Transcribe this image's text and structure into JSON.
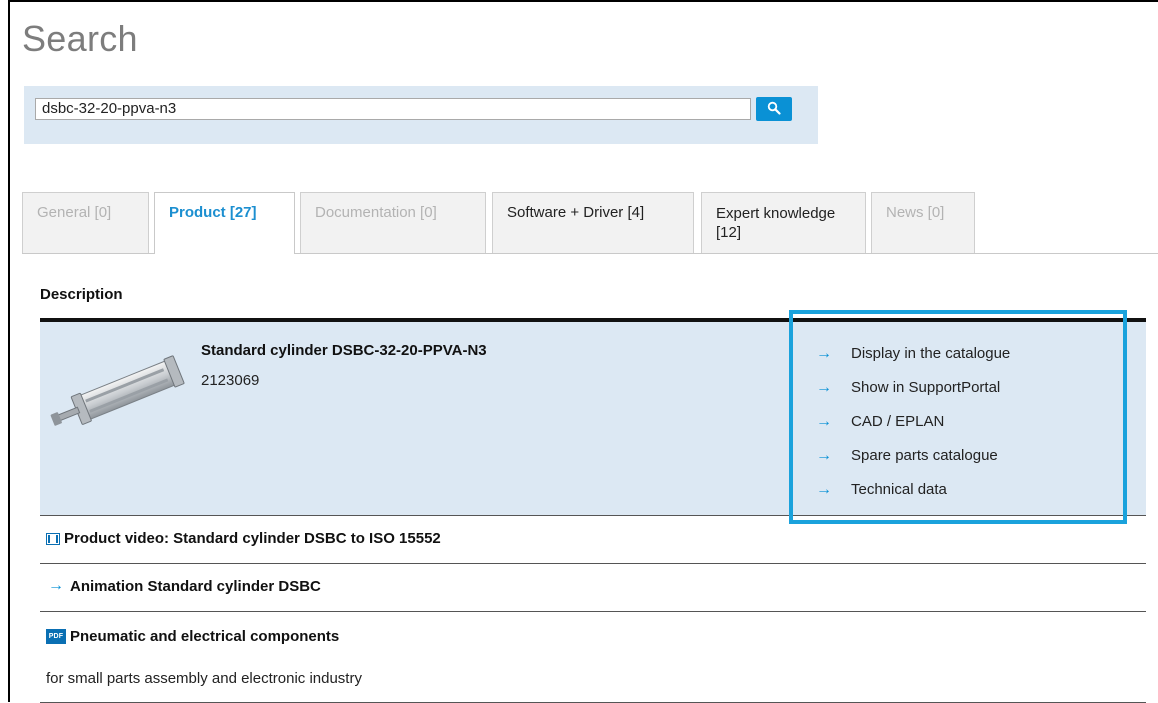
{
  "page": {
    "title": "Search"
  },
  "search": {
    "value": "dsbc-32-20-ppva-n3",
    "button_icon": "search-icon"
  },
  "tabs": [
    {
      "label": "General [0]",
      "state": "disabled"
    },
    {
      "label": "Product [27]",
      "state": "active"
    },
    {
      "label": "Documentation [0]",
      "state": "disabled"
    },
    {
      "label": "Software + Driver [4]",
      "state": "enabled"
    },
    {
      "label": "Expert knowledge [12]",
      "state": "enabled"
    },
    {
      "label": "News [0]",
      "state": "disabled"
    }
  ],
  "results": {
    "header": "Description",
    "product": {
      "title": "Standard cylinder DSBC-32-20-PPVA-N3",
      "number": "2123069",
      "actions": [
        "Display in the catalogue",
        "Show in SupportPortal",
        "CAD / EPLAN",
        "Spare parts catalogue",
        "Technical data"
      ]
    },
    "video": {
      "title": "Product video: Standard cylinder DSBC to ISO 15552",
      "icon": "film-icon"
    },
    "animation": {
      "title": "Animation Standard cylinder DSBC",
      "icon": "arrow-right-icon"
    },
    "document": {
      "title": "Pneumatic and electrical components",
      "subtitle": "for small parts assembly and electronic industry",
      "icon_label": "PDF"
    }
  },
  "colors": {
    "accent": "#0a91d5",
    "panel": "#dce8f3",
    "highlight": "#1aa2dc",
    "active_tab": "#1c8fd0"
  }
}
